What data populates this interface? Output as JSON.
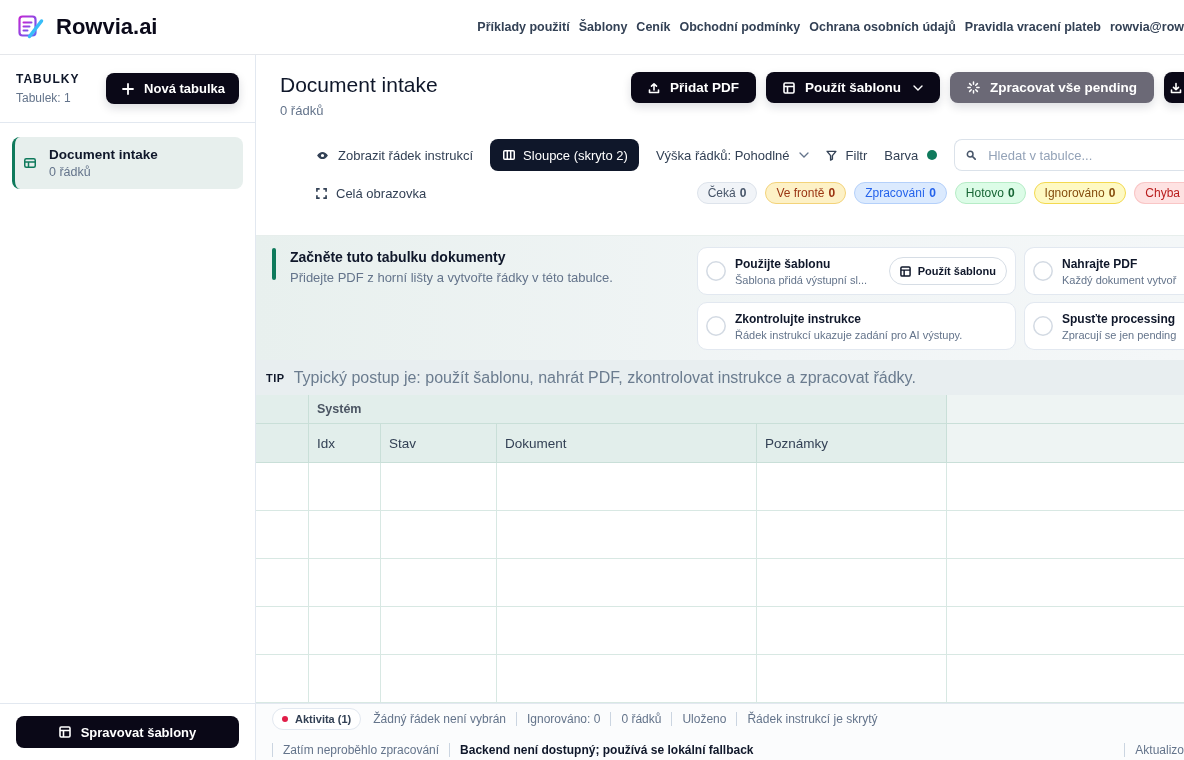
{
  "header": {
    "brand": "Rowvia.ai",
    "nav": [
      "Příklady použití",
      "Šablony",
      "Ceník",
      "Obchodní podmínky",
      "Ochrana osobních údajů",
      "Pravidla vracení plateb",
      "rowvia@row"
    ]
  },
  "sidebar": {
    "heading": "TABULKY",
    "count": "Tabulek: 1",
    "new_button": "Nová tabulka",
    "items": [
      {
        "name": "Document intake",
        "rows": "0 řádků",
        "selected": true
      }
    ],
    "manage_button": "Spravovat šablony"
  },
  "main": {
    "title": "Document intake",
    "subtitle": "0 řádků",
    "actions": [
      {
        "label": "Přidat PDF",
        "kind": "button",
        "disabled": false
      },
      {
        "label": "Použít šablonu",
        "kind": "menu",
        "disabled": false
      },
      {
        "label": "Zpracovat vše pending",
        "kind": "button",
        "disabled": true
      },
      {
        "kind": "button",
        "disabled": false
      }
    ]
  },
  "toolbar": {
    "instructions_toggle": "Zobrazit řádek instrukcí",
    "columns_button": "Sloupce (skryto 2)",
    "row_height": "Výška řádků: Pohodlné",
    "filter": "Filtr",
    "color_label": "Barva",
    "color": "#0f7a5c",
    "search": {
      "placeholder": "Hledat v tabulce..."
    },
    "fullscreen": "Celá obrazovka",
    "status_filters": [
      {
        "label": "Čeká",
        "count": "0",
        "kind": "waiting"
      },
      {
        "label": "Ve frontě",
        "count": "0",
        "kind": "queued"
      },
      {
        "label": "Zpracování",
        "count": "0",
        "kind": "processing"
      },
      {
        "label": "Hotovo",
        "count": "0",
        "kind": "done"
      },
      {
        "label": "Ignorováno",
        "count": "0",
        "kind": "ignored"
      },
      {
        "label": "Chyba",
        "kind": "error"
      }
    ]
  },
  "onboarding": {
    "title": "Začněte tuto tabulku dokumenty",
    "text": "Přidejte PDF z horní lišty a vytvořte řádky v této tabulce.",
    "steps": [
      {
        "title": "Použijte šablonu",
        "text": "Šablona přidá výstupní sl...",
        "done": false,
        "action": "Použít šablonu"
      },
      {
        "title": "Nahrajte PDF",
        "text": "Každý dokument vytvoř",
        "done": false
      },
      {
        "title": "Zkontrolujte instrukce",
        "text": "Řádek instrukcí ukazuje zadání pro AI výstupy.",
        "done": false
      },
      {
        "title": "Spusťte processing",
        "text": "Zpracují se jen pending",
        "done": false
      }
    ],
    "tip_label": "TIP",
    "tip": "Typický postup je: použít šablonu, nahrát PDF, zkontrolovat instrukce a zpracovat řádky."
  },
  "table": {
    "column_groups": [
      {
        "label": "Systém",
        "columns": [
          "Idx",
          "Stav",
          "Dokument",
          "Poznámky"
        ]
      }
    ]
  },
  "status_bar": {
    "activity": "Aktivita (1)",
    "items": [
      "Žádný řádek není vybrán",
      "Ignorováno: 0",
      "0 řádků",
      "Uloženo",
      "Řádek instrukcí je skrytý"
    ],
    "details": [
      {
        "text": "Zatím neproběhlo zpracování",
        "emphasis": false
      },
      {
        "text": "Backend není dostupný; používá se lokální fallback",
        "emphasis": true
      }
    ],
    "right": "Aktualizo"
  }
}
